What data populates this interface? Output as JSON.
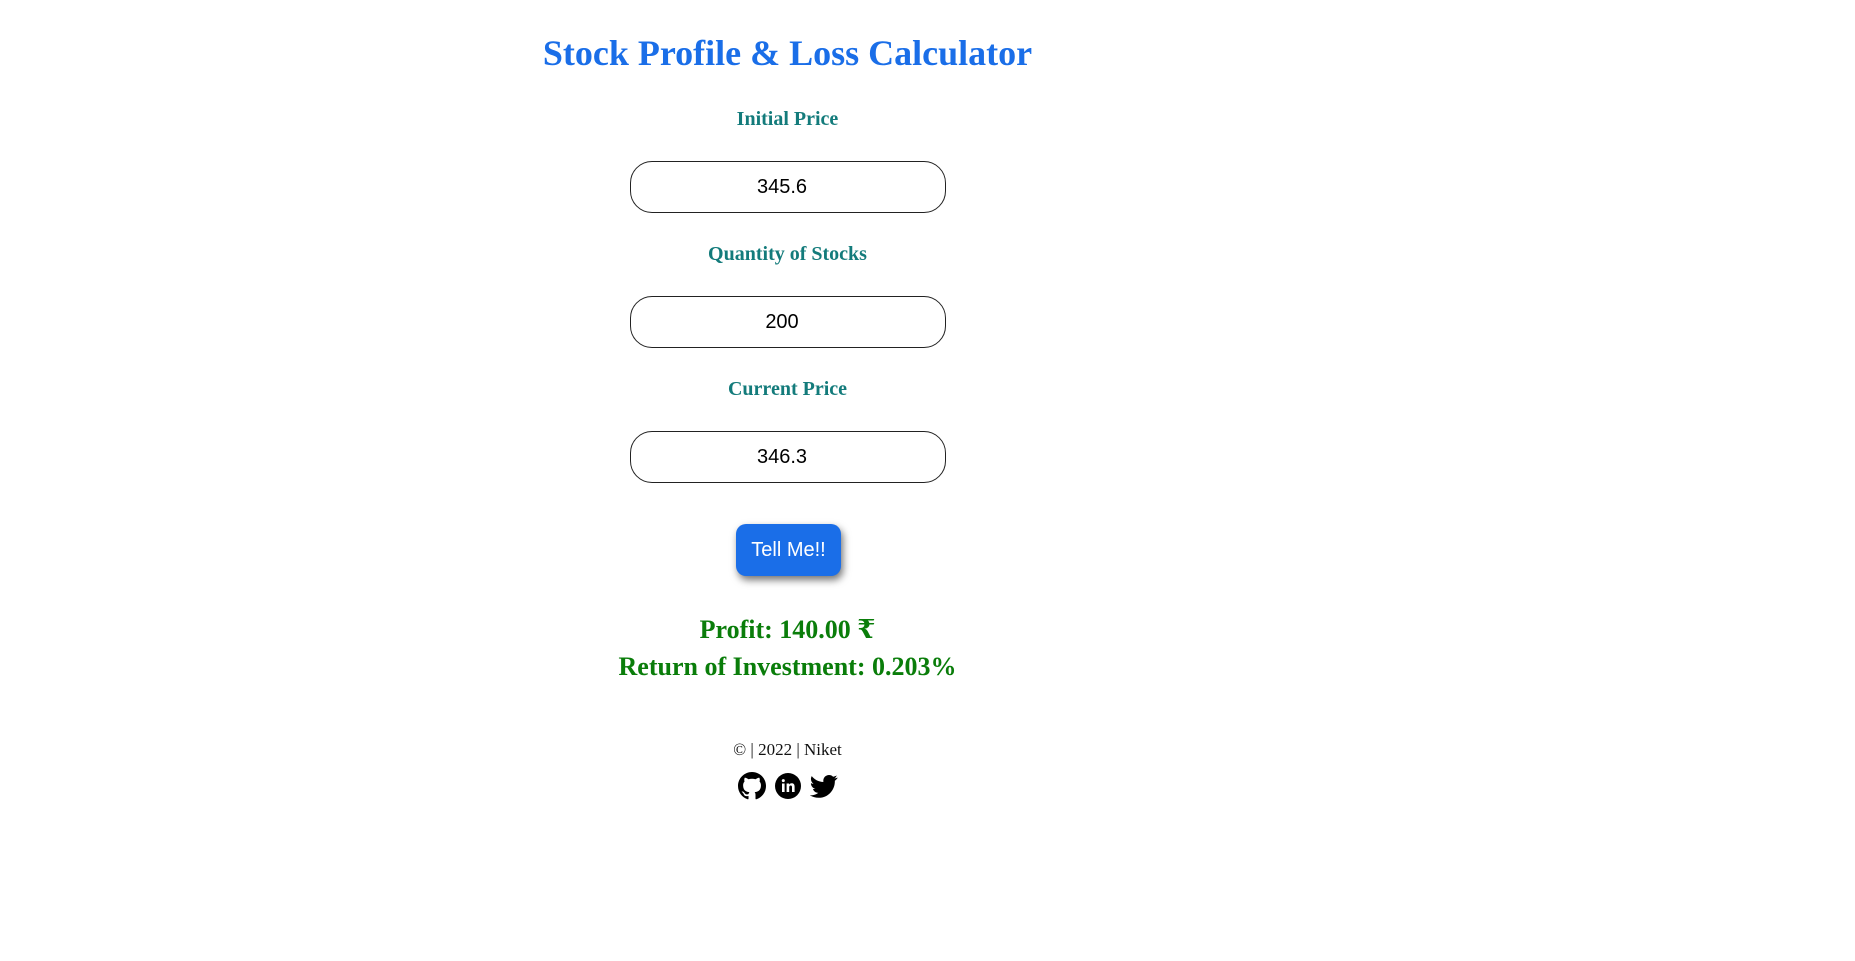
{
  "header": {
    "title": "Stock Profile & Loss Calculator"
  },
  "form": {
    "initial_price_label": "Initial Price",
    "initial_price_value": "345.6",
    "quantity_label": "Quantity of Stocks",
    "quantity_value": "200",
    "current_price_label": "Current Price",
    "current_price_value": "346.3",
    "submit_label": "Tell Me!!"
  },
  "result": {
    "profit_text": "Profit: 140.00 ₹",
    "roi_text": "Return of Investment: 0.203%",
    "color": "#0a7d0a"
  },
  "footer": {
    "text": "© | 2022 | Niket",
    "icons": [
      "github-icon",
      "linkedin-icon",
      "twitter-icon"
    ]
  },
  "colors": {
    "accent": "#1a6ee8",
    "label": "#137b7b"
  }
}
